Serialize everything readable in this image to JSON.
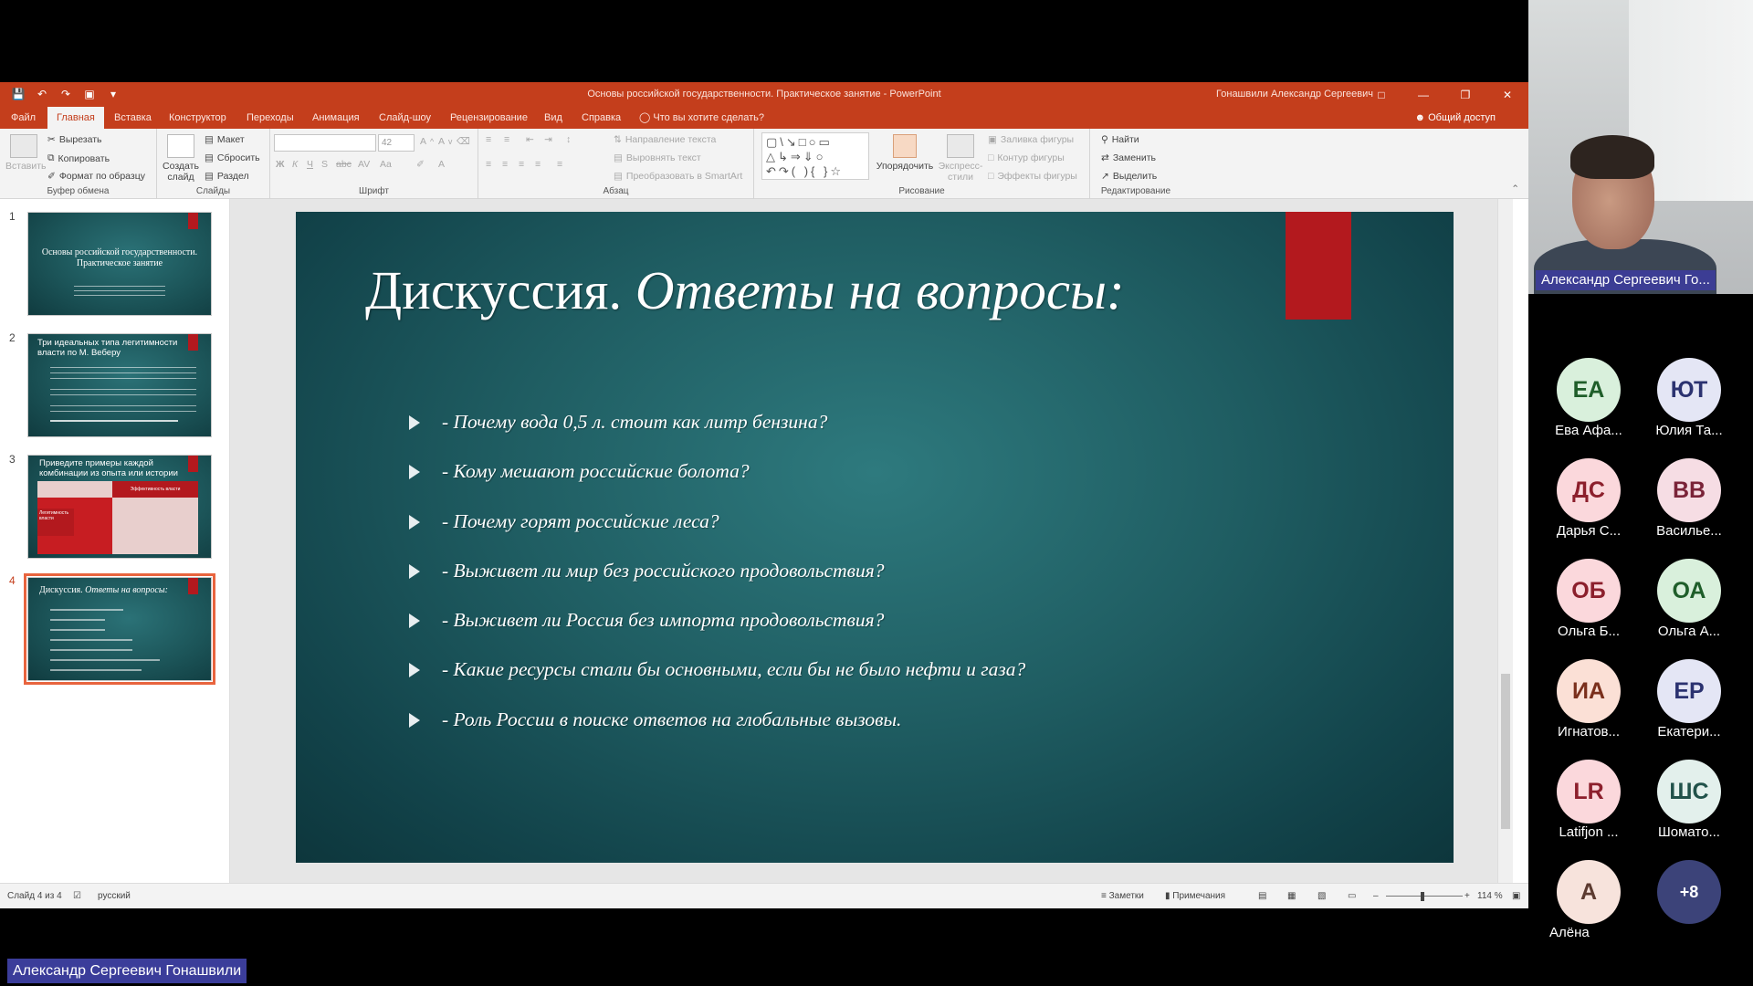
{
  "window": {
    "title": "Основы российской государственности. Практическое занятие  -  PowerPoint",
    "user": "Гонашвили Александр Сергеевич"
  },
  "tabs": [
    "Файл",
    "Главная",
    "Вставка",
    "Конструктор",
    "Переходы",
    "Анимация",
    "Слайд-шоу",
    "Рецензирование",
    "Вид",
    "Справка"
  ],
  "tell_me": "Что вы хотите сделать?",
  "share_label": "Общий доступ",
  "ribbon": {
    "clipboard": {
      "paste": "Вставить",
      "cut": "Вырезать",
      "copy": "Копировать",
      "format_painter": "Формат по образцу",
      "label": "Буфер обмена"
    },
    "slides": {
      "new_slide": "Создать слайд",
      "layout": "Макет",
      "reset": "Сбросить",
      "section": "Раздел",
      "label": "Слайды"
    },
    "font": {
      "size": "42",
      "label": "Шрифт"
    },
    "paragraph": {
      "text_direction": "Направление текста",
      "align_text": "Выровнять текст",
      "smartart": "Преобразовать в SmartArt",
      "label": "Абзац"
    },
    "drawing": {
      "arrange": "Упорядочить",
      "quick_styles": "Экспресс-стили",
      "fill": "Заливка фигуры",
      "outline": "Контур фигуры",
      "effects": "Эффекты фигуры",
      "label": "Рисование"
    },
    "editing": {
      "find": "Найти",
      "replace": "Заменить",
      "select": "Выделить",
      "label": "Редактирование"
    }
  },
  "thumbnails": [
    {
      "num": "1",
      "title": "Основы российской государственности. Практическое занятие"
    },
    {
      "num": "2",
      "title": "Три идеальных типа легитимности власти по М. Веберу"
    },
    {
      "num": "3",
      "title": "Приведите примеры каждой комбинации из опыта или истории",
      "cell_a": "Эффективность власти",
      "cell_b": "Легитимность власти"
    },
    {
      "num": "4",
      "title_plain": "Дискуссия.",
      "title_italic": "Ответы на вопросы:"
    }
  ],
  "slide": {
    "title_plain": "Дискуссия.",
    "title_italic": "Ответы на вопросы:",
    "bullets": [
      "- Почему вода 0,5 л. стоит как литр бензина?",
      "-  Кому мешают российские болота?",
      "- Почему горят российские леса?",
      "- Выживет ли мир без российского продовольствия?",
      "- Выживет ли Россия без импорта продовольствия?",
      "- Какие ресурсы стали бы основными, если бы не было нефти и газа?",
      "- Роль России в поиске ответов на глобальные вызовы."
    ]
  },
  "status": {
    "slide_info": "Слайд 4 из 4",
    "language": "русский",
    "notes": "Заметки",
    "comments": "Примечания",
    "zoom": "114 %"
  },
  "gallery": {
    "speaker_name": "Александр Сергеевич  Го...",
    "participants": [
      {
        "initials": "ЕА",
        "name": "Ева Афа...",
        "bg": "#d9f0dc",
        "fg": "#1f5e2a"
      },
      {
        "initials": "ЮТ",
        "name": "Юлия Та...",
        "bg": "#e4e6f5",
        "fg": "#2b3270"
      },
      {
        "initials": "ДС",
        "name": "Дарья С...",
        "bg": "#fbd8dc",
        "fg": "#8c1f2c"
      },
      {
        "initials": "ВВ",
        "name": "Василье...",
        "bg": "#f6dde4",
        "fg": "#7a2338"
      },
      {
        "initials": "ОБ",
        "name": "Ольга Б...",
        "bg": "#fbd8dc",
        "fg": "#8c1f2c"
      },
      {
        "initials": "ОА",
        "name": "Ольга А...",
        "bg": "#d9f0dc",
        "fg": "#1f5e2a"
      },
      {
        "initials": "ИА",
        "name": "Игнатов...",
        "bg": "#fbe0d6",
        "fg": "#7a2f1c"
      },
      {
        "initials": "ЕР",
        "name": "Екатери...",
        "bg": "#e4e6f5",
        "fg": "#2b3270"
      },
      {
        "initials": "LR",
        "name": "Latifjon ...",
        "bg": "#fbd8dc",
        "fg": "#8c1f2c"
      },
      {
        "initials": "ШС",
        "name": "Шомато...",
        "bg": "#e3f0ec",
        "fg": "#21524a"
      },
      {
        "initials": "А",
        "name": "Алёна",
        "bg": "#f7e3dc",
        "fg": "#5c3a30"
      }
    ],
    "more": "+8"
  },
  "bottom_name": "Александр Сергеевич  Гонашвили"
}
